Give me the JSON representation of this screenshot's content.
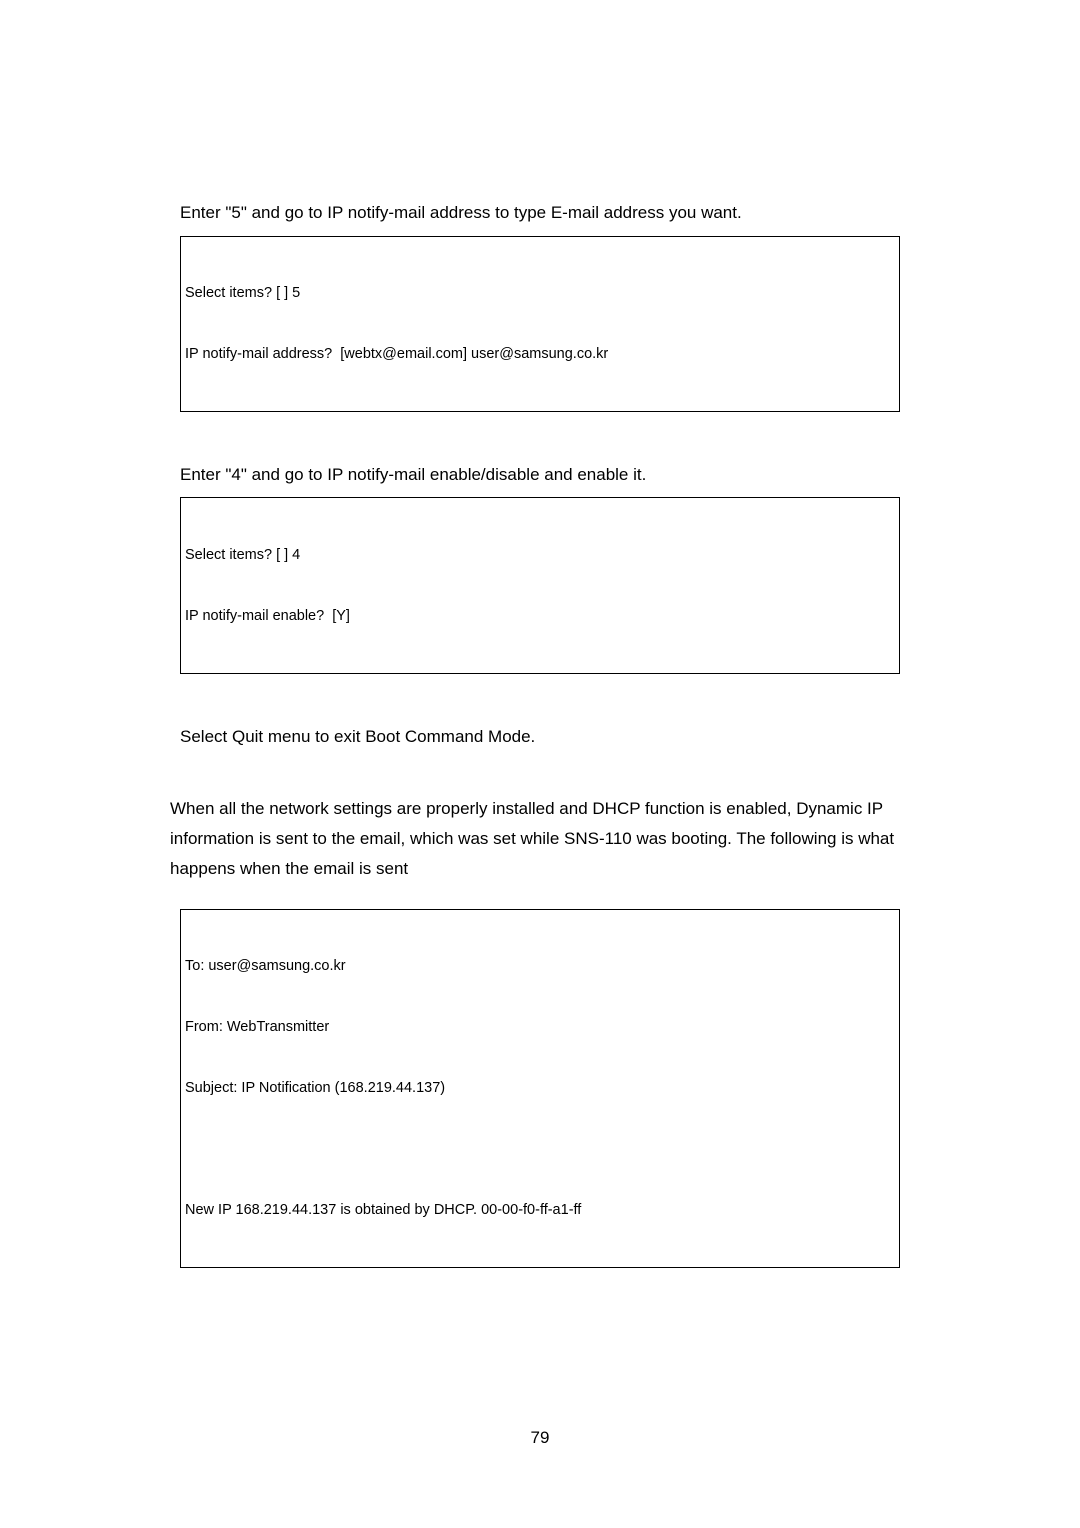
{
  "section1": {
    "instruction": "Enter \"5\" and go to IP notify-mail address to type E-mail address you want.",
    "line1": "Select items? [ ] 5",
    "line2": "IP notify-mail address?  [webtx@email.com] user@samsung.co.kr"
  },
  "section2": {
    "instruction": "Enter \"4\" and go to IP notify-mail enable/disable and enable it.",
    "line1": "Select items? [ ] 4",
    "line2": "IP notify-mail enable?  [Y]"
  },
  "section3": {
    "instruction": " Select Quit menu to exit Boot Command Mode."
  },
  "section4": {
    "body": "When all the network settings are properly installed and DHCP function is enabled, Dynamic IP information is sent to the email, which was set while SNS-110 was booting. The following is what happens when the email is sent"
  },
  "section5": {
    "line1": "To: user@samsung.co.kr",
    "line2": "From: WebTransmitter",
    "line3": "Subject: IP Notification (168.219.44.137)",
    "line4": "",
    "line5": "New IP 168.219.44.137 is obtained by DHCP. 00-00-f0-ff-a1-ff"
  },
  "pageNumber": "79"
}
